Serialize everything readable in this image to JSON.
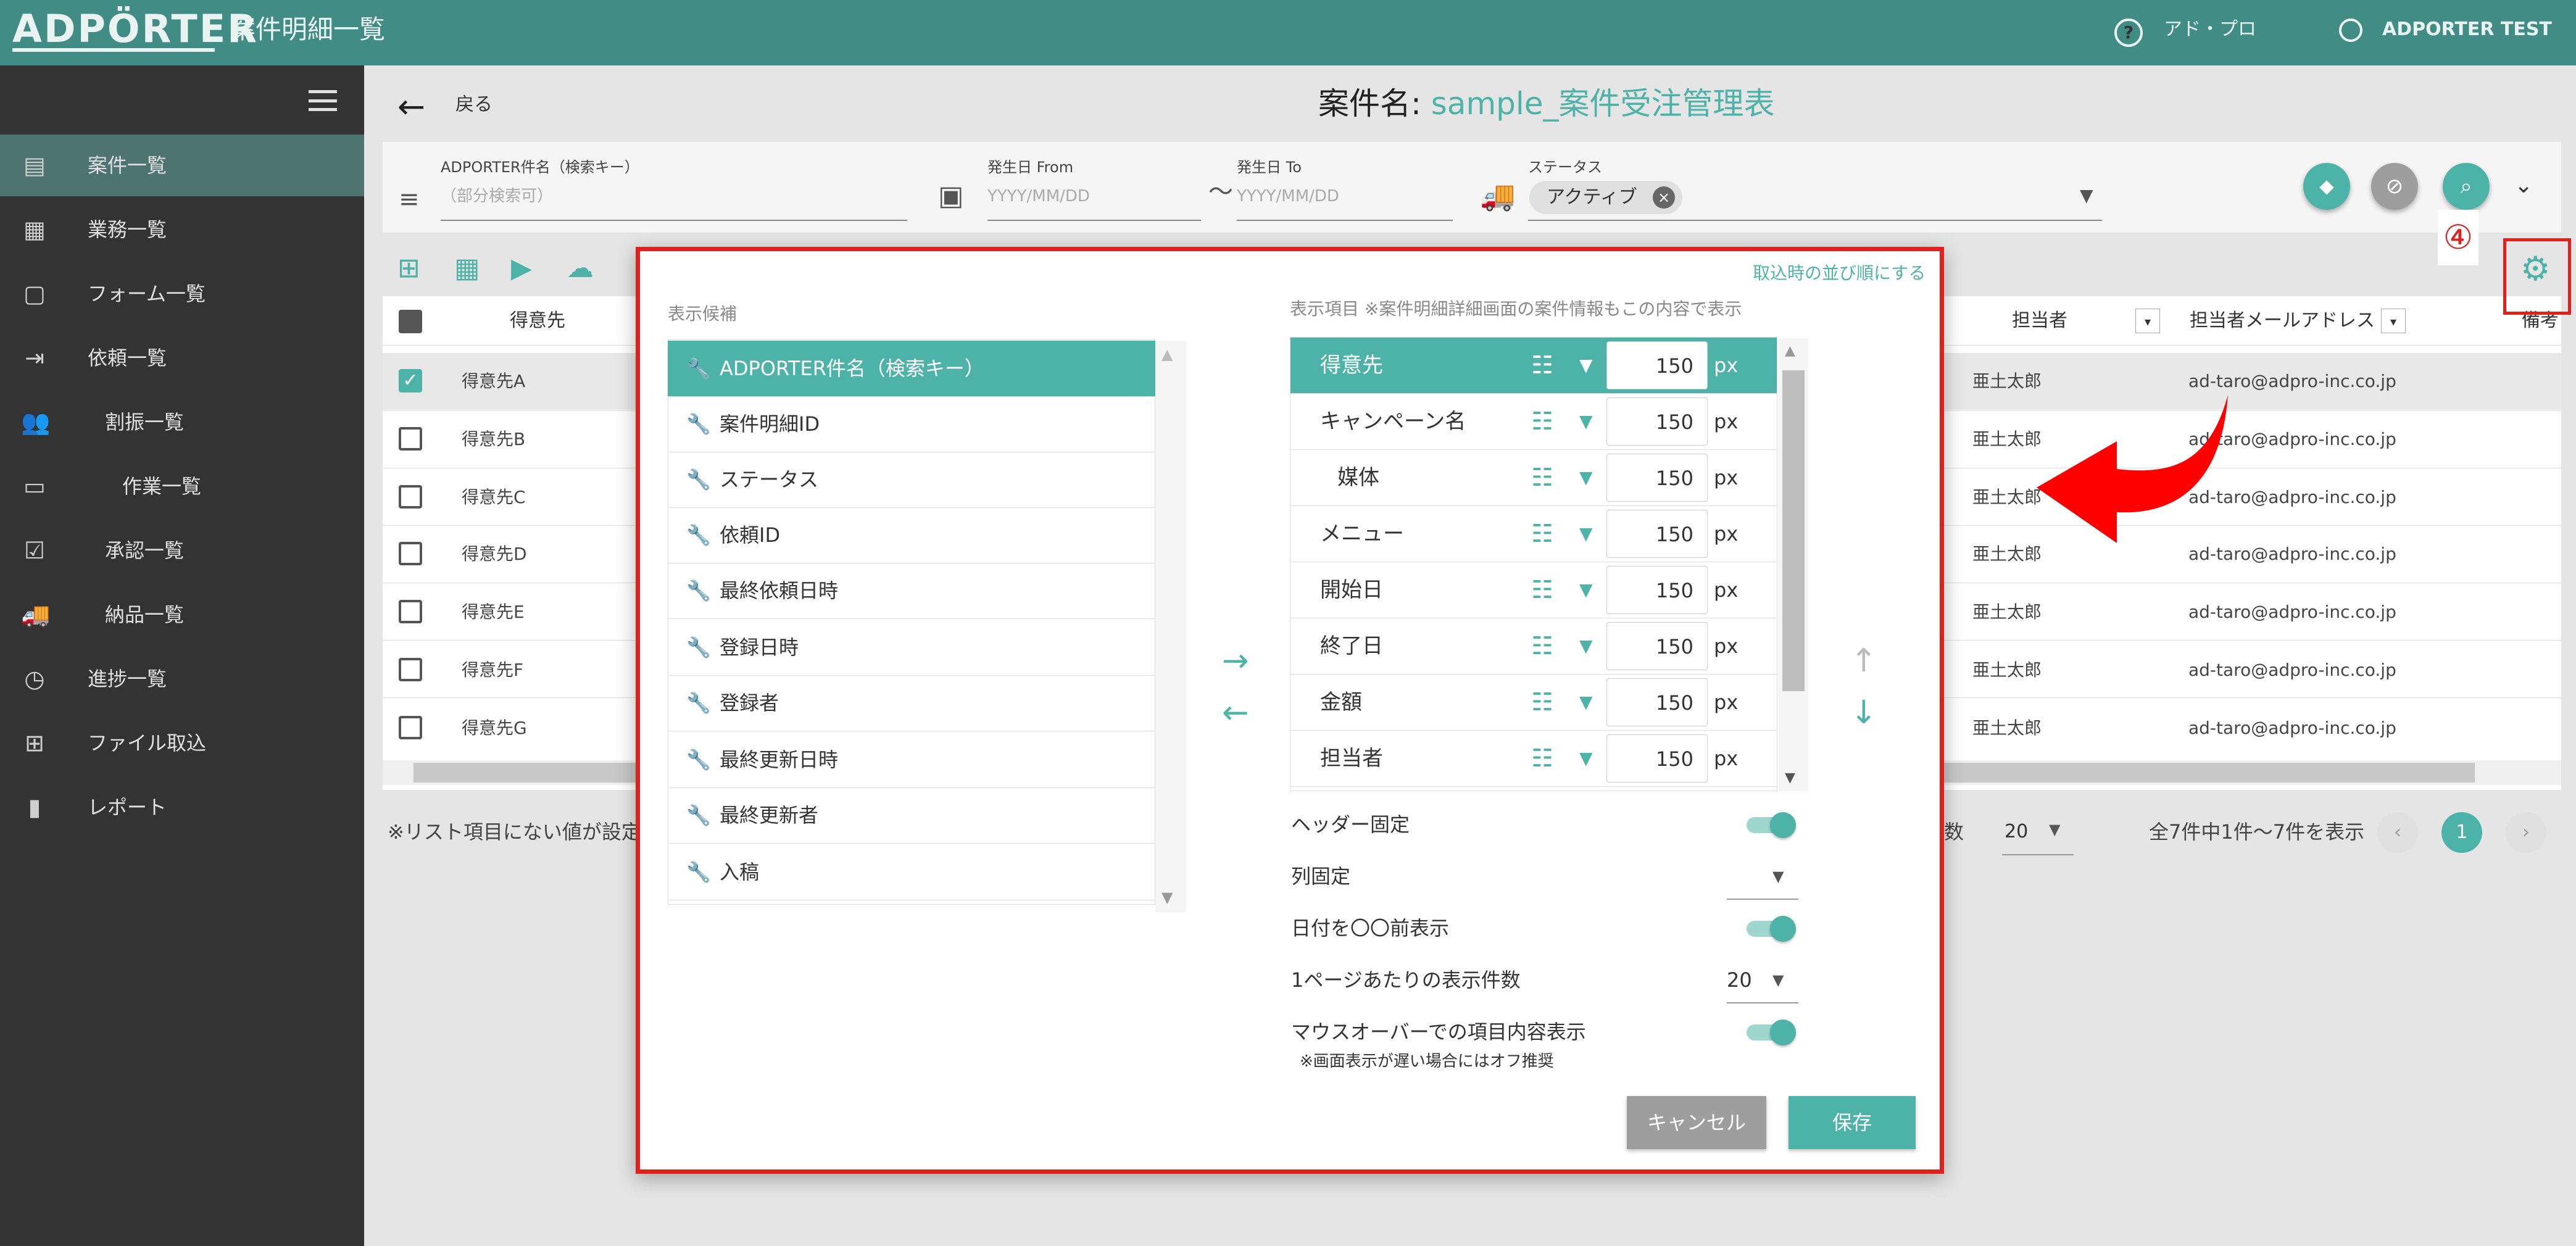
{
  "header": {
    "logo": "ADPÖRTER",
    "title": "案件明細一覧",
    "help_icon": "question-circle-icon",
    "org": "アド・プロ",
    "user": "ADPORTER TEST"
  },
  "sidebar": {
    "items": [
      {
        "label": "案件一覧",
        "icon": "document-icon",
        "active": true
      },
      {
        "label": "業務一覧",
        "icon": "building-icon"
      },
      {
        "label": "フォーム一覧",
        "icon": "form-icon"
      },
      {
        "label": "依頼一覧",
        "icon": "login-icon"
      },
      {
        "label": "割振一覧",
        "icon": "people-icon"
      },
      {
        "label": "作業一覧",
        "icon": "monitor-icon"
      },
      {
        "label": "承認一覧",
        "icon": "approval-icon"
      },
      {
        "label": "納品一覧",
        "icon": "truck-icon"
      },
      {
        "label": "進捗一覧",
        "icon": "clock-icon"
      },
      {
        "label": "ファイル取込",
        "icon": "table-add-icon"
      },
      {
        "label": "レポート",
        "icon": "bar-chart-icon"
      }
    ]
  },
  "page": {
    "back": "戻る",
    "case_label": "案件名:",
    "case_value": "sample_案件受注管理表"
  },
  "filters": {
    "key_label": "ADPORTER件名（検索キー）",
    "key_placeholder": "（部分検索可）",
    "from_label": "発生日 From",
    "from_placeholder": "YYYY/MM/DD",
    "tilde": "〜",
    "to_label": "発生日 To",
    "to_placeholder": "YYYY/MM/DD",
    "status_label": "ステータス",
    "status_chip": "アクティブ"
  },
  "table": {
    "col_client": "得意先",
    "col_person": "担当者",
    "col_email": "担当者メールアドレス",
    "col_notes": "備考",
    "rows": [
      {
        "client": "得意先A",
        "person": "亜土太郎",
        "email": "ad-taro@adpro-inc.co.jp",
        "checked": true
      },
      {
        "client": "得意先B",
        "person": "亜土太郎",
        "email": "ad-taro@adpro-inc.co.jp"
      },
      {
        "client": "得意先C",
        "person": "亜土太郎",
        "email": "ad-taro@adpro-inc.co.jp"
      },
      {
        "client": "得意先D",
        "person": "亜土太郎",
        "email": "ad-taro@adpro-inc.co.jp"
      },
      {
        "client": "得意先E",
        "person": "亜土太郎",
        "email": "ad-taro@adpro-inc.co.jp"
      },
      {
        "client": "得意先F",
        "person": "亜土太郎",
        "email": "ad-taro@adpro-inc.co.jp"
      },
      {
        "client": "得意先G",
        "person": "亜土太郎",
        "email": "ad-taro@adpro-inc.co.jp"
      }
    ],
    "note": "※リスト項目にない値が設定",
    "per_page_suffix": "数",
    "per_page": "20",
    "count": "全7件中1件〜7件を表示",
    "page": "1"
  },
  "annotation": {
    "number": "④"
  },
  "modal": {
    "reset_link": "取込時の並び順にする",
    "candidates_label": "表示候補",
    "display_label": "表示項目 ※案件明細詳細画面の案件情報もこの内容で表示",
    "candidates": [
      "ADPORTER件名（検索キー）",
      "案件明細ID",
      "ステータス",
      "依頼ID",
      "最終依頼日時",
      "登録日時",
      "登録者",
      "最終更新日時",
      "最終更新者",
      "入稿"
    ],
    "display": [
      {
        "label": "得意先",
        "width": "150"
      },
      {
        "label": "キャンペーン名",
        "width": "150"
      },
      {
        "label": "媒体",
        "width": "150"
      },
      {
        "label": "メニュー",
        "width": "150"
      },
      {
        "label": "開始日",
        "width": "150"
      },
      {
        "label": "終了日",
        "width": "150"
      },
      {
        "label": "金額",
        "width": "150"
      },
      {
        "label": "担当者",
        "width": "150"
      }
    ],
    "unit": "px",
    "opt_header_fixed": "ヘッダー固定",
    "opt_col_fixed": "列固定",
    "opt_date_relative": "日付を〇〇前表示",
    "opt_per_page": "1ページあたりの表示件数",
    "opt_per_page_value": "20",
    "opt_hover": "マウスオーバーでの項目内容表示",
    "opt_hover_note": "※画面表示が遅い場合にはオフ推奨",
    "cancel": "キャンセル",
    "save": "保存"
  }
}
